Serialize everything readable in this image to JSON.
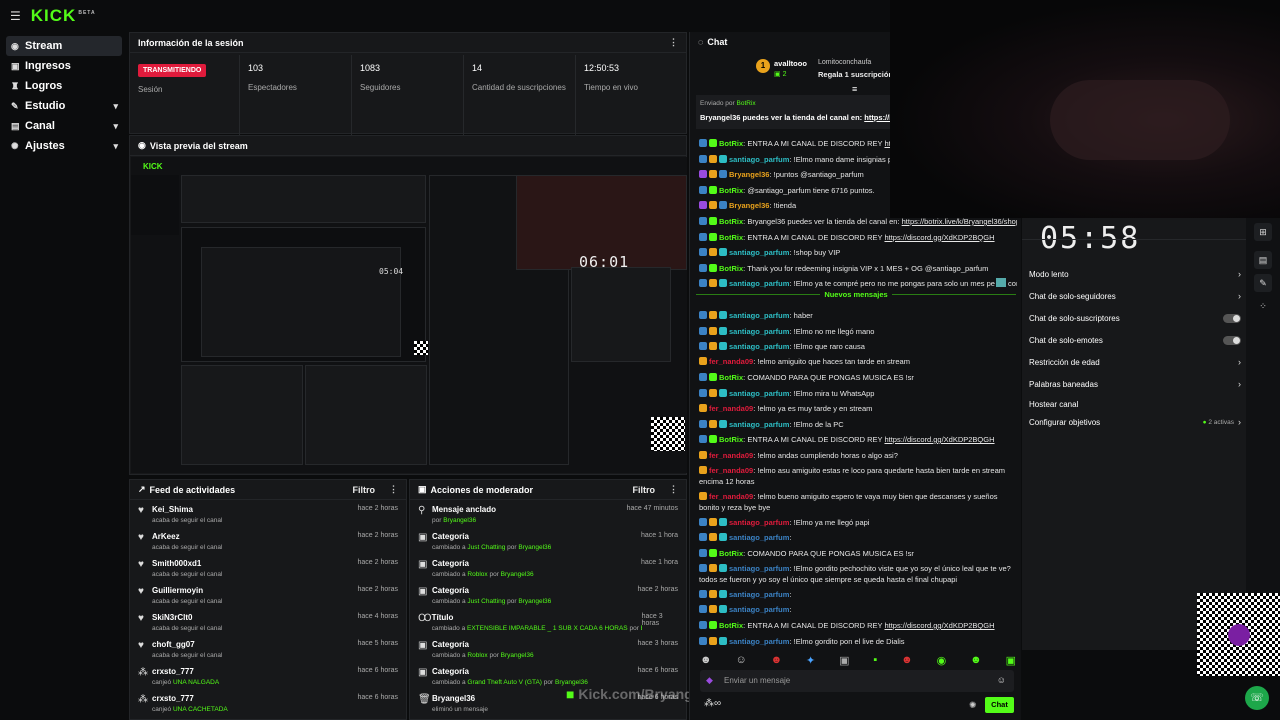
{
  "app": {
    "logo": "KICK",
    "logo_sup": "BETA"
  },
  "sidebar": {
    "items": [
      {
        "label": "Stream",
        "icon": "broadcast-icon"
      },
      {
        "label": "Ingresos",
        "icon": "wallet-icon"
      },
      {
        "label": "Logros",
        "icon": "trophy-icon"
      },
      {
        "label": "Estudio",
        "icon": "studio-icon"
      },
      {
        "label": "Canal",
        "icon": "channel-icon"
      },
      {
        "label": "Ajustes",
        "icon": "gear-icon"
      }
    ]
  },
  "session": {
    "title": "Información de la sesión",
    "status": "TRANSMITIENDO",
    "status_label": "Sesión",
    "stats": [
      {
        "value": "103",
        "label": "Espectadores"
      },
      {
        "value": "1083",
        "label": "Seguidores"
      },
      {
        "value": "14",
        "label": "Cantidad de suscripciones"
      },
      {
        "value": "12:50:53",
        "label": "Tiempo en vivo"
      }
    ]
  },
  "preview": {
    "title": "Vista previa del stream",
    "timer": "06:01",
    "timer_nested": "05:04",
    "watermark": "Kick.com/Bryangel36"
  },
  "activity": {
    "title": "Feed de actividades",
    "filter": "Filtro",
    "items": [
      {
        "user": "Kei_Shima",
        "action": "acaba de seguir el canal",
        "time": "hace 2 horas",
        "type": "follow"
      },
      {
        "user": "ArKeez",
        "action": "acaba de seguir el canal",
        "time": "hace 2 horas",
        "type": "follow"
      },
      {
        "user": "Smith000xd1",
        "action": "acaba de seguir el canal",
        "time": "hace 2 horas",
        "type": "follow"
      },
      {
        "user": "Guilliermoyin",
        "action": "acaba de seguir el canal",
        "time": "hace 2 horas",
        "type": "follow"
      },
      {
        "user": "SkiN3rClt0",
        "action": "acaba de seguir el canal",
        "time": "hace 4 horas",
        "type": "follow"
      },
      {
        "user": "choft_gg07",
        "action": "acaba de seguir el canal",
        "time": "hace 5 horas",
        "type": "follow"
      },
      {
        "user": "crxsto_777",
        "action": "canjeó ",
        "reward": "UNA NALGADA",
        "time": "hace 6 horas",
        "type": "redeem"
      },
      {
        "user": "crxsto_777",
        "action": "canjeó ",
        "reward": "UNA CACHETADA",
        "time": "hace 6 horas",
        "type": "redeem"
      }
    ]
  },
  "modactions": {
    "title": "Acciones de moderador",
    "filter": "Filtro",
    "items": [
      {
        "title": "Mensaje anclado",
        "pre": "por ",
        "target": "",
        "mid": "",
        "by": "Bryangel36",
        "time": "hace 47 minutos",
        "icon": "pin-icon"
      },
      {
        "title": "Categoría",
        "pre": "cambiado a ",
        "target": "Just Chatting",
        "mid": " por ",
        "by": "Bryangel36",
        "time": "hace 1 hora",
        "icon": "category-icon"
      },
      {
        "title": "Categoría",
        "pre": "cambiado a ",
        "target": "Roblox",
        "mid": " por ",
        "by": "Bryangel36",
        "time": "hace 1 hora",
        "icon": "category-icon"
      },
      {
        "title": "Categoría",
        "pre": "cambiado a ",
        "target": "Just Chatting",
        "mid": " por ",
        "by": "Bryangel36",
        "time": "hace 2 horas",
        "icon": "category-icon"
      },
      {
        "title": "Título",
        "pre": "cambiado a ",
        "target": "EXTENSIBLE IMPARABLE _ 1 SUB X CADA 6 HORAS",
        "mid": " por ",
        "by": "Bryangel36",
        "time": "hace 3 horas",
        "icon": "title-icon"
      },
      {
        "title": "Categoría",
        "pre": "cambiado a ",
        "target": "Roblox",
        "mid": " por ",
        "by": "Bryangel36",
        "time": "hace 3 horas",
        "icon": "category-icon"
      },
      {
        "title": "Categoría",
        "pre": "cambiado a ",
        "target": "Grand Theft Auto V (GTA)",
        "mid": " por ",
        "by": "Bryangel36",
        "time": "hace 6 horas",
        "icon": "category-icon"
      },
      {
        "title": "Bryangel36",
        "pre": "eliminó un mensaje",
        "target": "",
        "mid": "",
        "by": "",
        "time": "hace 6 horas",
        "icon": "delete-icon"
      }
    ]
  },
  "chat": {
    "title": "Chat",
    "gift": {
      "user": "avalltooo",
      "count": "2",
      "recipient": "Lomitoconchaufa",
      "text": "Regala 1 suscripción pa"
    },
    "pinned": {
      "sent_by": "Enviado por",
      "sender": "BotRix",
      "user": "Bryangel36",
      "text": " puedes ver la tienda del canal en: ",
      "link": "https://bot"
    },
    "messages_before": [
      {
        "user": "BotRix",
        "text": ": ENTRA A MI CANAL DE DISCORD REY ",
        "link": "https://disc",
        "color": "#53fc18"
      },
      {
        "user": "santiago_parfum",
        "text": ": !Elmo mano dame insignias pe yo siemp",
        "link": "",
        "color": "#2dbdc4"
      },
      {
        "user": "Bryangel36",
        "text": ": !puntos @santiago_parfum",
        "link": "",
        "color": "#e9a21c"
      },
      {
        "user": "BotRix",
        "text": ": @santiago_parfum tiene 6716 puntos.",
        "link": "",
        "color": "#53fc18"
      },
      {
        "user": "Bryangel36",
        "text": ": !tienda",
        "link": "",
        "color": "#e9a21c"
      },
      {
        "user": "BotRix",
        "text": ": Bryangel36 puedes ver la tienda del canal en: ",
        "link": "https://botrix.live/k/Bryangel36/shop",
        "color": "#53fc18"
      },
      {
        "user": "BotRix",
        "text": ": ENTRA A MI CANAL DE DISCORD REY ",
        "link": "https://discord.gg/XdKDP2BQGH",
        "color": "#53fc18"
      },
      {
        "user": "santiago_parfum",
        "text": ": !shop buy VIP",
        "link": "",
        "color": "#2dbdc4"
      },
      {
        "user": "BotRix",
        "text": ": Thank you for redeeming insignia VIP x 1 MES + OG @santiago_parfum",
        "link": "",
        "color": "#53fc18"
      },
      {
        "user": "santiago_parfum",
        "text": ": !Elmo ya te compré pero no me pongas para solo un mes pe",
        "link": "",
        "color": "#2dbdc4",
        "tail": " con yapita"
      }
    ],
    "new_label": "Nuevos mensajes",
    "messages_after": [
      {
        "user": "santiago_parfum",
        "text": ": haber",
        "color": "#2dbdc4",
        "link": ""
      },
      {
        "user": "santiago_parfum",
        "text": ": !Elmo no me llegó mano",
        "color": "#2dbdc4",
        "link": ""
      },
      {
        "user": "santiago_parfum",
        "text": ": !Elmo que raro causa",
        "color": "#2dbdc4",
        "link": ""
      },
      {
        "user": "fer_nanda09",
        "text": ": !elmo amiguito que haces tan tarde en stream",
        "color": "#e01b3c",
        "link": ""
      },
      {
        "user": "BotRix",
        "text": ": COMANDO PARA QUE PONGAS MUSICA ES !sr",
        "color": "#53fc18",
        "link": ""
      },
      {
        "user": "santiago_parfum",
        "text": ": !Elmo mira tu WhatsApp",
        "color": "#2dbdc4",
        "link": ""
      },
      {
        "user": "fer_nanda09",
        "text": ": !elmo ya es muy tarde y en stream",
        "color": "#e01b3c",
        "link": ""
      },
      {
        "user": "santiago_parfum",
        "text": ": !Elmo de la PC",
        "color": "#2dbdc4",
        "link": ""
      },
      {
        "user": "BotRix",
        "text": ": ENTRA A MI CANAL DE DISCORD REY ",
        "color": "#53fc18",
        "link": "https://discord.gg/XdKDP2BQGH"
      },
      {
        "user": "fer_nanda09",
        "text": ": !elmo andas cumpliendo horas o algo asi?",
        "color": "#e01b3c",
        "link": ""
      },
      {
        "user": "fer_nanda09",
        "text": ": !elmo asu amiguito estas re loco para quedarte hasta bien tarde en stream encima 12 horas",
        "color": "#e01b3c",
        "link": ""
      },
      {
        "user": "fer_nanda09",
        "text": ": !elmo bueno amiguito espero te vaya muy bien que descanses y sueños bonito y reza bye bye",
        "color": "#e01b3c",
        "link": ""
      },
      {
        "user": "santiago_parfum",
        "text": ": !Elmo ya me llegó papi",
        "color": "#e01b3c",
        "link": ""
      },
      {
        "user": "santiago_parfum",
        "text": ":",
        "color": "#3b82c4",
        "link": ""
      },
      {
        "user": "BotRix",
        "text": ": COMANDO PARA QUE PONGAS MUSICA ES !sr",
        "color": "#53fc18",
        "link": ""
      },
      {
        "user": "santiago_parfum",
        "text": ": !Elmo gordito pechochito viste que yo soy el único leal que te ve? todos se fueron y yo soy el único que siempre se queda hasta el final chupapi",
        "color": "#3b82c4",
        "link": ""
      },
      {
        "user": "santiago_parfum",
        "text": ":",
        "color": "#3b82c4",
        "link": ""
      },
      {
        "user": "santiago_parfum",
        "text": ":",
        "color": "#3b82c4",
        "link": ""
      },
      {
        "user": "BotRix",
        "text": ": ENTRA A MI CANAL DE DISCORD REY ",
        "color": "#53fc18",
        "link": "https://discord.gg/XdKDP2BQGH"
      },
      {
        "user": "santiago_parfum",
        "text": ": !Elmo gordito pon el live de Dialis",
        "color": "#3b82c4",
        "link": ""
      }
    ],
    "input_placeholder": "Enviar un mensaje",
    "send_label": "Chat",
    "points": "∞"
  },
  "camera": {
    "timer": "05:58",
    "label": "Enviar"
  },
  "modsettings": {
    "items": [
      {
        "label": "Modo lento",
        "control": "chevron"
      },
      {
        "label": "Chat de solo-seguidores",
        "control": "chevron"
      },
      {
        "label": "Chat de solo-suscriptores",
        "control": "toggle"
      },
      {
        "label": "Chat de solo-emotes",
        "control": "toggle"
      },
      {
        "label": "Restricción de edad",
        "control": "chevron"
      },
      {
        "label": "Palabras baneadas",
        "control": "chevron"
      },
      {
        "label": "Hostear canal",
        "control": "none"
      },
      {
        "label": "Configurar objetivos",
        "control": "chevron",
        "extra": "2 activas"
      }
    ]
  }
}
